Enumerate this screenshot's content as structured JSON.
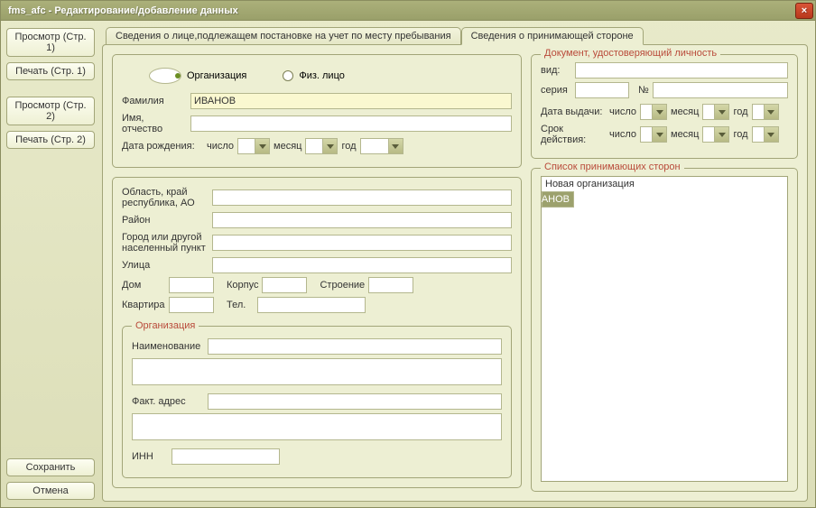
{
  "window": {
    "title": "fms_afc - Редактирование/добавление данных"
  },
  "sidebar": {
    "view1": "Просмотр (Стр. 1)",
    "print1": "Печать (Стр. 1)",
    "view2": "Просмотр (Стр. 2)",
    "print2": "Печать (Стр. 2)",
    "save": "Сохранить",
    "cancel": "Отмена"
  },
  "tabs": {
    "tab1": "Сведения о лице,подлежащем постановке на учет по месту пребывания",
    "tab2": "Сведения о принимающей стороне"
  },
  "type": {
    "org": "Организация",
    "person": "Физ. лицо",
    "selected": "org"
  },
  "person": {
    "surname_label": "Фамилия",
    "surname_value": "ИВАНОВ",
    "name_label": "Имя, отчество",
    "name_value": "",
    "dob_label": "Дата рождения:",
    "num_label": "число",
    "month_label": "месяц",
    "year_label": "год"
  },
  "address": {
    "region_label": "Область, край республика, АО",
    "district_label": "Район",
    "city_label": "Город или другой населенный пункт",
    "street_label": "Улица",
    "house_label": "Дом",
    "corp_label": "Корпус",
    "building_label": "Строение",
    "flat_label": "Квартира",
    "phone_label": "Тел."
  },
  "org": {
    "legend": "Организация",
    "name_label": "Наименование",
    "addr_label": "Факт. адрес",
    "inn_label": "ИНН"
  },
  "doc": {
    "legend": "Документ, удостоверяющий личность",
    "kind_label": "вид:",
    "series_label": "серия",
    "number_label": "№",
    "issue_label": "Дата выдачи:",
    "expiry_label": "Срок действия:",
    "num_label": "число",
    "month_label": "месяц",
    "year_label": "год"
  },
  "hostlist": {
    "legend": "Список принимающих сторон",
    "items": [
      "Новая организация",
      "ИВАНОВ"
    ],
    "selected_index": 1
  }
}
